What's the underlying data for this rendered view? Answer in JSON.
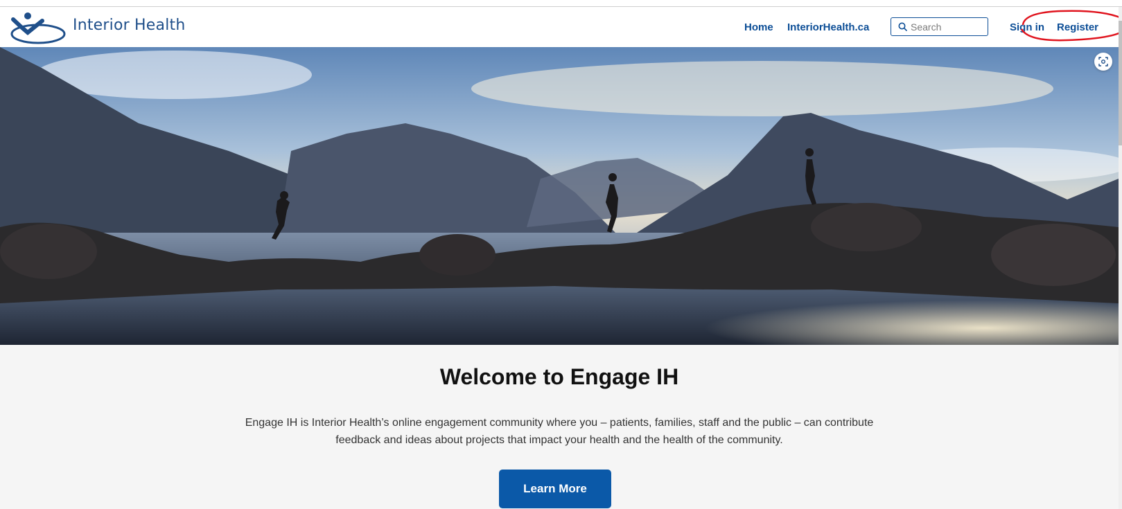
{
  "header": {
    "brand": "Interior Health",
    "nav": {
      "home": "Home",
      "site": "InteriorHealth.ca",
      "sign_in": "Sign in",
      "register": "Register"
    },
    "search": {
      "placeholder": "Search"
    },
    "logo_icon": "interior-health-logo-icon",
    "search_icon": "search-icon"
  },
  "hero": {
    "image_description_icon": "lake-mountain-photo",
    "capture_icon": "screenshot-capture-icon"
  },
  "main": {
    "title": "Welcome to Engage IH",
    "description_line1": "Engage IH is Interior Health’s online engagement community where you – patients, families, staff and the public – can contribute",
    "description_line2": "feedback and ideas about projects that impact your health and the health of the community.",
    "cta": "Learn More"
  },
  "colors": {
    "brand_blue": "#0b4d96",
    "button_blue": "#0b59a8",
    "annotation_red": "#e0141e",
    "background": "#f5f5f5"
  }
}
